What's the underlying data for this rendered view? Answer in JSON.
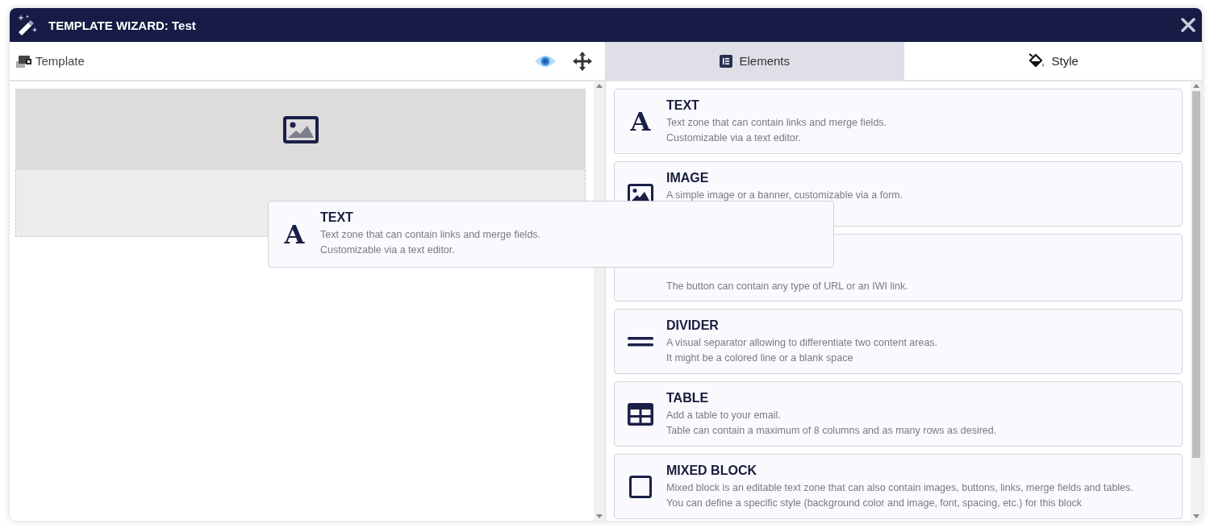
{
  "window": {
    "title": "TEMPLATE WIZARD: Test"
  },
  "template_panel": {
    "title": "Template",
    "blocks": [
      {
        "kind": "image"
      },
      {
        "kind": "empty"
      }
    ]
  },
  "tabs": [
    {
      "label": "Elements",
      "selected": true
    },
    {
      "label": "Style",
      "selected": false
    }
  ],
  "elements": [
    {
      "kind": "text",
      "glyph": "A",
      "title": "TEXT",
      "lines": [
        "Text zone that can contain links and merge fields.",
        "Customizable via a text editor."
      ]
    },
    {
      "kind": "image",
      "title": "IMAGE",
      "lines": [
        "A simple image or a banner, customizable via a form."
      ]
    },
    {
      "kind": "button",
      "lines": [
        "The button can contain any type of URL or an IWI link."
      ]
    },
    {
      "kind": "divider",
      "title": "DIVIDER",
      "lines": [
        "A visual separator allowing to differentiate two content areas.",
        "It might be a colored line or a blank space"
      ]
    },
    {
      "kind": "table",
      "title": "TABLE",
      "lines": [
        "Add a table to your email.",
        "Table can contain a maximum of 8 columns and as many rows as desired."
      ]
    },
    {
      "kind": "mixed",
      "title": "MIXED BLOCK",
      "lines": [
        "Mixed block is an editable text zone that can also contain images, buttons, links, merge fields and tables.",
        "You can define a specific style (background color and image, font, spacing, etc.) for this block"
      ]
    }
  ],
  "dragged_element": {
    "kind": "text",
    "glyph": "A",
    "title": "TEXT",
    "lines": [
      "Text zone that can contain links and merge fields.",
      "Customizable via a text editor."
    ]
  }
}
